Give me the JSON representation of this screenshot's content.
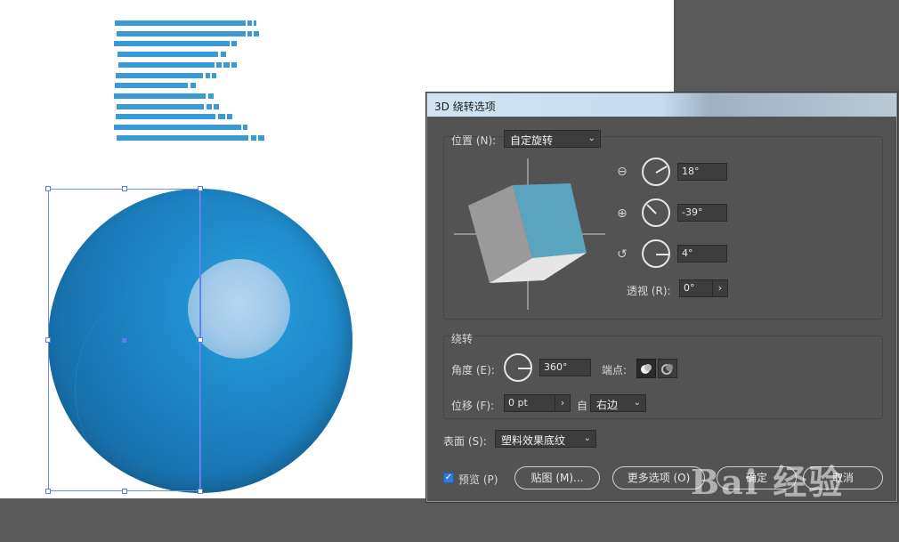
{
  "dialog": {
    "title": "3D 绕转选项",
    "position": {
      "label": "位置 (N):",
      "preset": "自定旋转",
      "x_rotation": "18°",
      "y_rotation": "-39°",
      "z_rotation": "4°",
      "perspective_label": "透视 (R):",
      "perspective": "0°"
    },
    "revolve": {
      "section_label": "绕转",
      "angle_label": "角度 (E):",
      "angle": "360°",
      "cap_label": "端点:",
      "offset_label": "位移 (F):",
      "offset": "0 pt",
      "from_label": "自",
      "from_edge": "右边"
    },
    "surface": {
      "label": "表面 (S):",
      "value": "塑料效果底纹"
    },
    "buttons": {
      "preview_label": "预览 (P)",
      "map_art": "贴图 (M)...",
      "more_options": "更多选项 (O)",
      "ok": "确定",
      "cancel": "取消"
    },
    "preview_checked": true
  },
  "icons": {
    "x_axis": "x-rotate-icon",
    "y_axis": "y-rotate-icon",
    "z_axis": "z-rotate-icon",
    "cap_on": "cap-on-icon",
    "cap_off": "cap-off-icon",
    "dropdown": "chevron-down-icon",
    "stepper": "chevron-right-icon"
  },
  "watermark": "Bai 经验",
  "colors": {
    "stripe": "#3a9ad6",
    "sphere": "#1d86c6",
    "dialog_bg": "#535353",
    "selection": "#5a7cf2"
  }
}
